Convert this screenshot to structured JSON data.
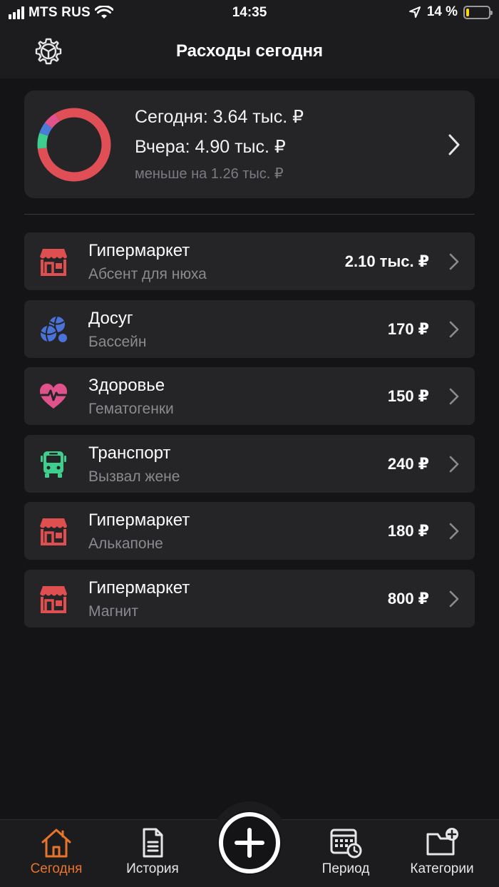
{
  "status_bar": {
    "carrier": "MTS RUS",
    "time": "14:35",
    "battery_percent": "14 %",
    "battery_level": 0.14
  },
  "nav": {
    "title": "Расходы сегодня",
    "settings_icon": "gear-icon"
  },
  "summary": {
    "today": "Сегодня: 3.64 тыс. ₽",
    "yesterday": "Вчера: 4.90 тыс. ₽",
    "difference": "меньше на 1.26 тыс. ₽",
    "donut_segments": [
      {
        "color": "#e04f55",
        "fraction": 0.82
      },
      {
        "color": "#3ecf8e",
        "fraction": 0.07
      },
      {
        "color": "#4a7bd6",
        "fraction": 0.05
      },
      {
        "color": "#e0528c",
        "fraction": 0.06
      }
    ]
  },
  "expenses": [
    {
      "category": "Гипермаркет",
      "note": "Абсент для нюха",
      "amount": "2.10 тыс. ₽",
      "icon": "store-icon",
      "color": "#e04f4f"
    },
    {
      "category": "Досуг",
      "note": "Бассейн",
      "amount": "170 ₽",
      "icon": "balls-icon",
      "color": "#4a73d9"
    },
    {
      "category": "Здоровье",
      "note": "Гематогенки",
      "amount": "150 ₽",
      "icon": "heart-pulse-icon",
      "color": "#e0528c"
    },
    {
      "category": "Транспорт",
      "note": "Вызвал жене",
      "amount": "240 ₽",
      "icon": "bus-icon",
      "color": "#3ecf8e"
    },
    {
      "category": "Гипермаркет",
      "note": "Алькапоне",
      "amount": "180 ₽",
      "icon": "store-icon",
      "color": "#e04f4f"
    },
    {
      "category": "Гипермаркет",
      "note": "Магнит",
      "amount": "800 ₽",
      "icon": "store-icon",
      "color": "#e04f4f"
    }
  ],
  "tabs": [
    {
      "label": "Сегодня",
      "icon": "home-icon",
      "active": true
    },
    {
      "label": "История",
      "icon": "document-icon",
      "active": false
    },
    {
      "label": "Период",
      "icon": "calendar-clock-icon",
      "active": false
    },
    {
      "label": "Категории",
      "icon": "folder-plus-icon",
      "active": false
    }
  ],
  "colors": {
    "accent": "#e8732a",
    "background": "#141417",
    "card": "#252528"
  }
}
